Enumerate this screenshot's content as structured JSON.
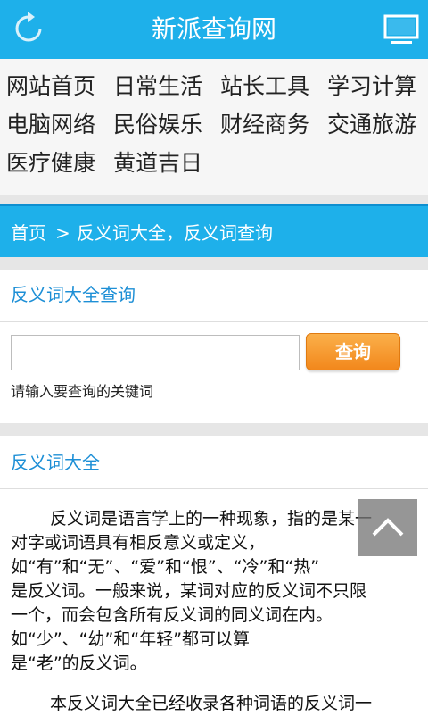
{
  "header": {
    "title": "新派查询网",
    "left_icon": "refresh-icon",
    "right_icon": "monitor-icon"
  },
  "nav": {
    "items": [
      "网站首页",
      "日常生活",
      "站长工具",
      "学习计算",
      "电脑网络",
      "民俗娱乐",
      "财经商务",
      "交通旅游",
      "医疗健康",
      "黄道吉日"
    ]
  },
  "breadcrumb": {
    "home": "首页",
    "separator": ">",
    "current": "反义词大全，反义词查询"
  },
  "search": {
    "section_title": "反义词大全查询",
    "input_value": "",
    "input_placeholder": "",
    "button_label": "查询",
    "hint": "请输入要查询的关键词"
  },
  "article": {
    "section_title": "反义词大全",
    "lines": [
      "反义词是语言学上的一种现象，指的是某一",
      "对字或词语具有相反意义或定义，",
      "如“有”和“无”、“爱”和“恨”、“冷”和“热”",
      "是反义词。一般来说，某词对应的反义词不只限",
      "一个，而会包含所有反义词的同义词在内。",
      "如“少”、“幼”和“年轻”都可以算",
      "是“老”的反义词。"
    ],
    "paragraph2": "本反义词大全已经收录各种词语的反义词一"
  },
  "float_button": {
    "icon": "chevron-up-icon"
  },
  "colors": {
    "brand_blue": "#1eb0ea",
    "link_blue": "#1d8fd6",
    "button_orange": "#f2881c"
  }
}
